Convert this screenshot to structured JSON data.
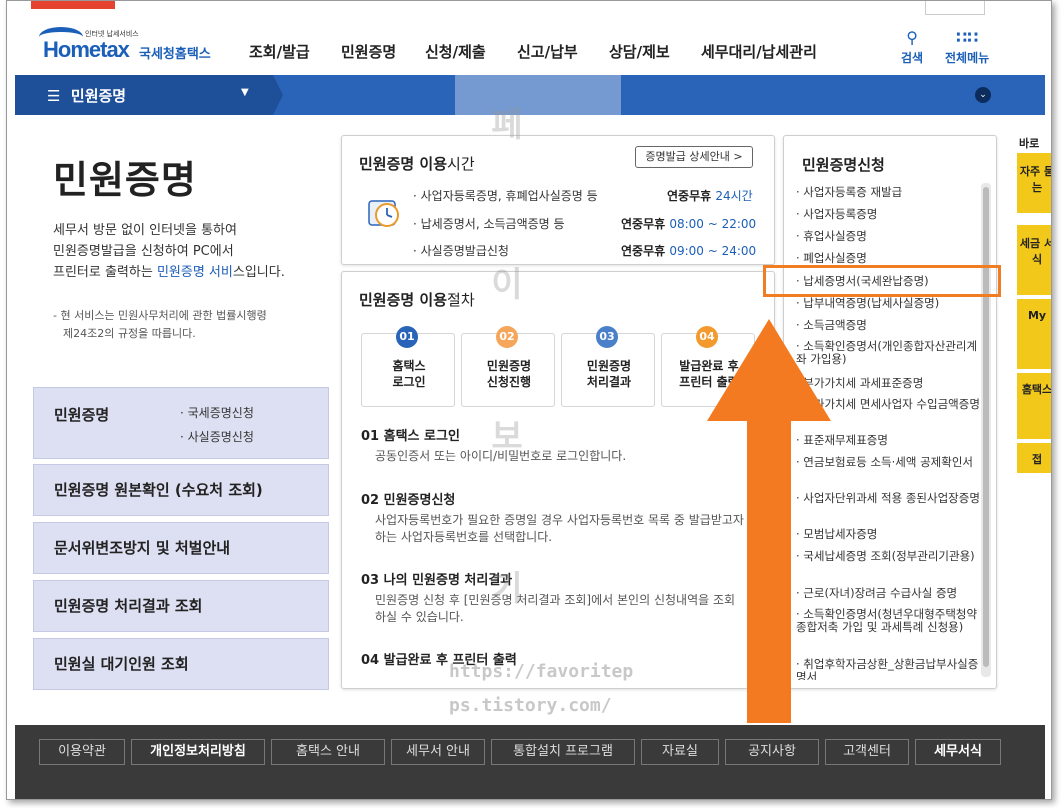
{
  "header": {
    "logo_tagline": "인터넷 납세서비스",
    "logo_text": "Hometax",
    "logo_kr": "국세청홈택스",
    "nav": [
      "조회/발급",
      "민원증명",
      "신청/제출",
      "신고/납부",
      "상담/제보",
      "세무대리/납세관리"
    ],
    "search_label": "검색",
    "menu_label": "전체메뉴"
  },
  "subnav": {
    "current": "민원증명"
  },
  "left": {
    "title": "민원증명",
    "desc": [
      {
        "a": "세무서 방문 없이 인터넷을 통하여",
        "hl": "",
        "b": ""
      },
      {
        "a": "민원증명발급을 신청하여 PC에서",
        "hl": "",
        "b": ""
      },
      {
        "a": "프린터로 출력하는 ",
        "hl": "민원증명 서비",
        "b": "스입니다."
      }
    ],
    "note": [
      "- 현 서비스는 민원사무처리에 관한 법률시행령",
      "  제24조2의 규정을 따릅니다."
    ],
    "buttons": [
      {
        "label": "민원증명",
        "subs": [
          "· 국세증명신청",
          "· 사실증명신청"
        ]
      },
      {
        "label": "민원증명 원본확인 (수요처 조회)"
      },
      {
        "label": "문서위변조방지 및 처벌안내"
      },
      {
        "label": "민원증명 처리결과 조회"
      },
      {
        "label": "민원실 대기인원 조회"
      }
    ]
  },
  "hours": {
    "title_a": "민원증명 이용",
    "title_b": "시간",
    "detail_button": "증명발급 상세안내 >",
    "rows": [
      {
        "label": "· 사업자등록증명, 휴폐업사실증명 등",
        "pre": "연중무휴 ",
        "val": "24시간"
      },
      {
        "label": "· 납세증명서, 소득금액증명 등",
        "pre": "연중무휴 ",
        "val": "08:00 ~ 22:00"
      },
      {
        "label": "· 사실증명발급신청",
        "pre": "연중무휴 ",
        "val": "09:00 ~ 24:00"
      }
    ]
  },
  "procedure": {
    "title_a": "민원증명 이용",
    "title_b": "절차",
    "steps": [
      {
        "num": "01",
        "l1": "홈택스",
        "l2": "로그인",
        "color": "#2a64b9"
      },
      {
        "num": "02",
        "l1": "민원증명",
        "l2": "신청진행",
        "color": "#f5a65b"
      },
      {
        "num": "03",
        "l1": "민원증명",
        "l2": "처리결과",
        "color": "#4a7fc9"
      },
      {
        "num": "04",
        "l1": "발급완료 후",
        "l2": "프린터 출력",
        "color": "#f39a2e"
      }
    ],
    "details": [
      {
        "head": "01 홈택스 로그인",
        "lines": [
          "공동인증서 또는 아이디/비밀번호로 로그인합니다."
        ]
      },
      {
        "head": "02 민원증명신청",
        "lines": [
          "사업자등록번호가 필요한 증명일 경우 사업자등록번호 목록 중 발급받고자",
          "하는 사업자등록번호를 선택합니다."
        ]
      },
      {
        "head": "03 나의 민원증명 처리결과",
        "lines": [
          "민원증명 신청 후 [민원증명 처리결과 조회]에서 본인의 신청내역을 조회",
          "하실 수 있습니다."
        ]
      },
      {
        "head": "04 발급완료 후 프린터 출력",
        "lines": []
      }
    ]
  },
  "certlist": {
    "title": "민원증명신청",
    "items": [
      "· 사업자등록증 재발급",
      "· 사업자등록증명",
      "· 휴업사실증명",
      "· 폐업사실증명",
      "· 납세증명서(국세완납증명)",
      "· 납부내역증명(납세사실증명)",
      "· 소득금액증명",
      "· 소득확인증명서(개인종합자산관리계좌 가입용)",
      "· 부가가치세 과세표준증명",
      "· 부가가치세 면세사업자 수입금액증명",
      "· 표준재무제표증명",
      "· 연금보험료등 소득·세액 공제확인서",
      "· 사업자단위과세 적용 종된사업장증명",
      "· 모범납세자증명",
      "· 국세납세증명 조회(정부관리기관용)",
      "· 근로(자녀)장려금 수급사실 증명",
      "· 소득확인증명서(청년우대형주택청약종합저축 가입 및 과세특례 신청용)",
      "· 취업후학자금상환_상환금납부사실증명서"
    ]
  },
  "right_tabs": [
    "바로",
    "자주 묻는",
    "세금 서식",
    "My",
    "홈택스",
    "접"
  ],
  "footer": {
    "links": [
      "이용약관",
      "개인정보처리방침",
      "홈택스 안내",
      "세무서 안내",
      "통합설치 프로그램",
      "자료실",
      "공지사항",
      "고객센터",
      "세무서식"
    ]
  },
  "watermark": {
    "chars": [
      "페",
      "이",
      "보",
      "기"
    ],
    "url1": "https://favoritep",
    "url2": "ps.tistory.com/"
  },
  "annotation_color": "#f07d22"
}
